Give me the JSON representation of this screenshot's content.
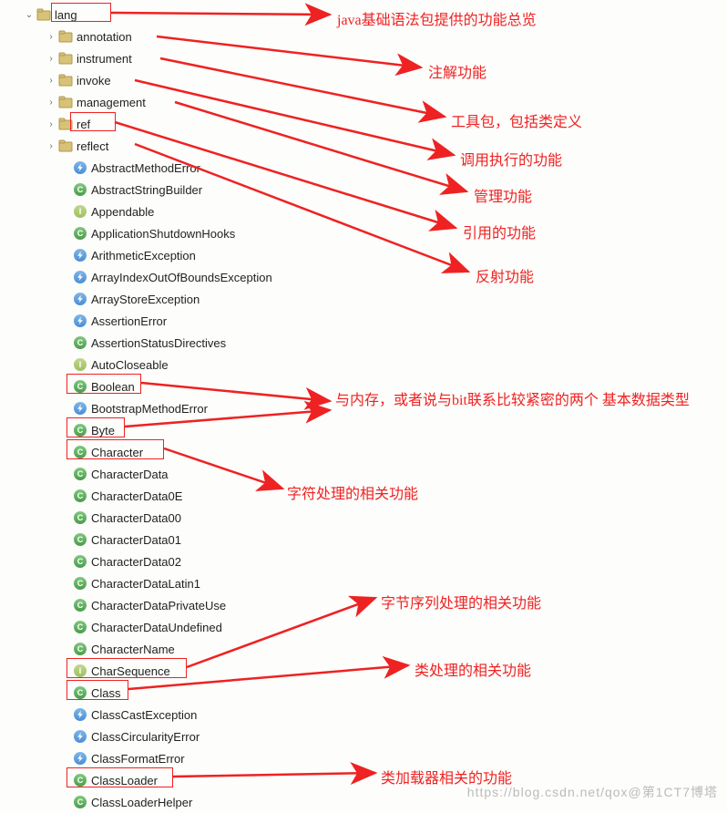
{
  "tree": {
    "root": {
      "label": "lang",
      "icon": "package",
      "expanded": true,
      "indent": 24
    },
    "folders": [
      {
        "label": "annotation",
        "icon": "package",
        "collapsed": true
      },
      {
        "label": "instrument",
        "icon": "package",
        "collapsed": true
      },
      {
        "label": "invoke",
        "icon": "package",
        "collapsed": true
      },
      {
        "label": "management",
        "icon": "package",
        "collapsed": true
      },
      {
        "label": "ref",
        "icon": "package",
        "collapsed": true
      },
      {
        "label": "reflect",
        "icon": "package",
        "collapsed": true
      }
    ],
    "classes": [
      {
        "label": "AbstractMethodError",
        "icon": "error"
      },
      {
        "label": "AbstractStringBuilder",
        "icon": "class"
      },
      {
        "label": "Appendable",
        "icon": "interface"
      },
      {
        "label": "ApplicationShutdownHooks",
        "icon": "class"
      },
      {
        "label": "ArithmeticException",
        "icon": "error"
      },
      {
        "label": "ArrayIndexOutOfBoundsException",
        "icon": "error"
      },
      {
        "label": "ArrayStoreException",
        "icon": "error"
      },
      {
        "label": "AssertionError",
        "icon": "error"
      },
      {
        "label": "AssertionStatusDirectives",
        "icon": "class"
      },
      {
        "label": "AutoCloseable",
        "icon": "interface"
      },
      {
        "label": "Boolean",
        "icon": "class"
      },
      {
        "label": "BootstrapMethodError",
        "icon": "error"
      },
      {
        "label": "Byte",
        "icon": "class"
      },
      {
        "label": "Character",
        "icon": "class"
      },
      {
        "label": "CharacterData",
        "icon": "class"
      },
      {
        "label": "CharacterData0E",
        "icon": "class"
      },
      {
        "label": "CharacterData00",
        "icon": "class"
      },
      {
        "label": "CharacterData01",
        "icon": "class"
      },
      {
        "label": "CharacterData02",
        "icon": "class"
      },
      {
        "label": "CharacterDataLatin1",
        "icon": "class"
      },
      {
        "label": "CharacterDataPrivateUse",
        "icon": "class"
      },
      {
        "label": "CharacterDataUndefined",
        "icon": "class"
      },
      {
        "label": "CharacterName",
        "icon": "class"
      },
      {
        "label": "CharSequence",
        "icon": "interface"
      },
      {
        "label": "Class",
        "icon": "class"
      },
      {
        "label": "ClassCastException",
        "icon": "error"
      },
      {
        "label": "ClassCircularityError",
        "icon": "error"
      },
      {
        "label": "ClassFormatError",
        "icon": "error"
      },
      {
        "label": "ClassLoader",
        "icon": "class"
      },
      {
        "label": "ClassLoaderHelper",
        "icon": "class"
      }
    ]
  },
  "annotations": {
    "a1": "java基础语法包提供的功能总览",
    "a2": "注解功能",
    "a3": "工具包，包括类定义",
    "a4": "调用执行的功能",
    "a5": "管理功能",
    "a6": "引用的功能",
    "a7": "反射功能",
    "a8": "与内存，或者说与bit联系比较紧密的两个  基本数据类型",
    "a9": "字符处理的相关功能",
    "a10": "字节序列处理的相关功能",
    "a11": "类处理的相关功能",
    "a12": "类加载器相关的功能"
  },
  "icon_letters": {
    "class": "C",
    "interface": "I",
    "error": ""
  },
  "watermark": "https://blog.csdn.net/qox@第1CT7博塔"
}
